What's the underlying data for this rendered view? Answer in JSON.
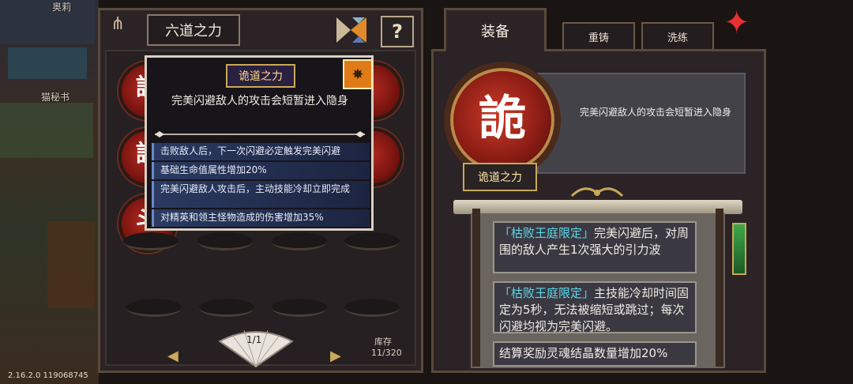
{
  "world": {
    "label_top": "奥莉",
    "label_side": "猫秘书"
  },
  "left_panel": {
    "title": "六道之力",
    "help_label": "?",
    "page_indicator": "1/1",
    "prev_arrow": "◀",
    "next_arrow": "▶",
    "storage_label": "库存",
    "storage_value": "11/320",
    "medal_glyph_1": "詭",
    "medal_glyph_2": "詭",
    "medal_glyph_3": "斗"
  },
  "tooltip": {
    "name": "诡道之力",
    "badge_icon": "star-badge-icon",
    "badge_glyph": "✸",
    "description": "完美闪避敌人的攻击会短暂进入隐身",
    "effects": [
      "击败敌人后，下一次闪避必定触发完美闪避",
      "基础生命值属性增加20%",
      "完美闪避敌人攻击后，主动技能冷却立即完成",
      "对精英和领主怪物造成的伤害增加35%"
    ]
  },
  "right_panel": {
    "tab_main": "装备",
    "tab_reforge": "重铸",
    "tab_refine": "洗练",
    "medal_glyph": "詭",
    "item_name": "诡道之力",
    "item_description": "完美闪避敌人的攻击会短暂进入隐身",
    "effects": [
      {
        "tag": "「枯败王庭限定」",
        "text": "完美闪避后，对周围的敌人产生1次强大的引力波"
      },
      {
        "tag": "「枯败王庭限定」",
        "text": "主技能冷却时间固定为5秒，无法被缩短或跳过；每次闪避均视为完美闪避。"
      },
      {
        "tag": "",
        "text": "结算奖励灵魂结晶数量增加20%"
      }
    ]
  },
  "version": "2.16.2.0 119068745",
  "colors": {
    "accent_gold": "#c9a85a",
    "highlight_cyan": "#5fd6e8",
    "medal_red": "#b22a20"
  }
}
